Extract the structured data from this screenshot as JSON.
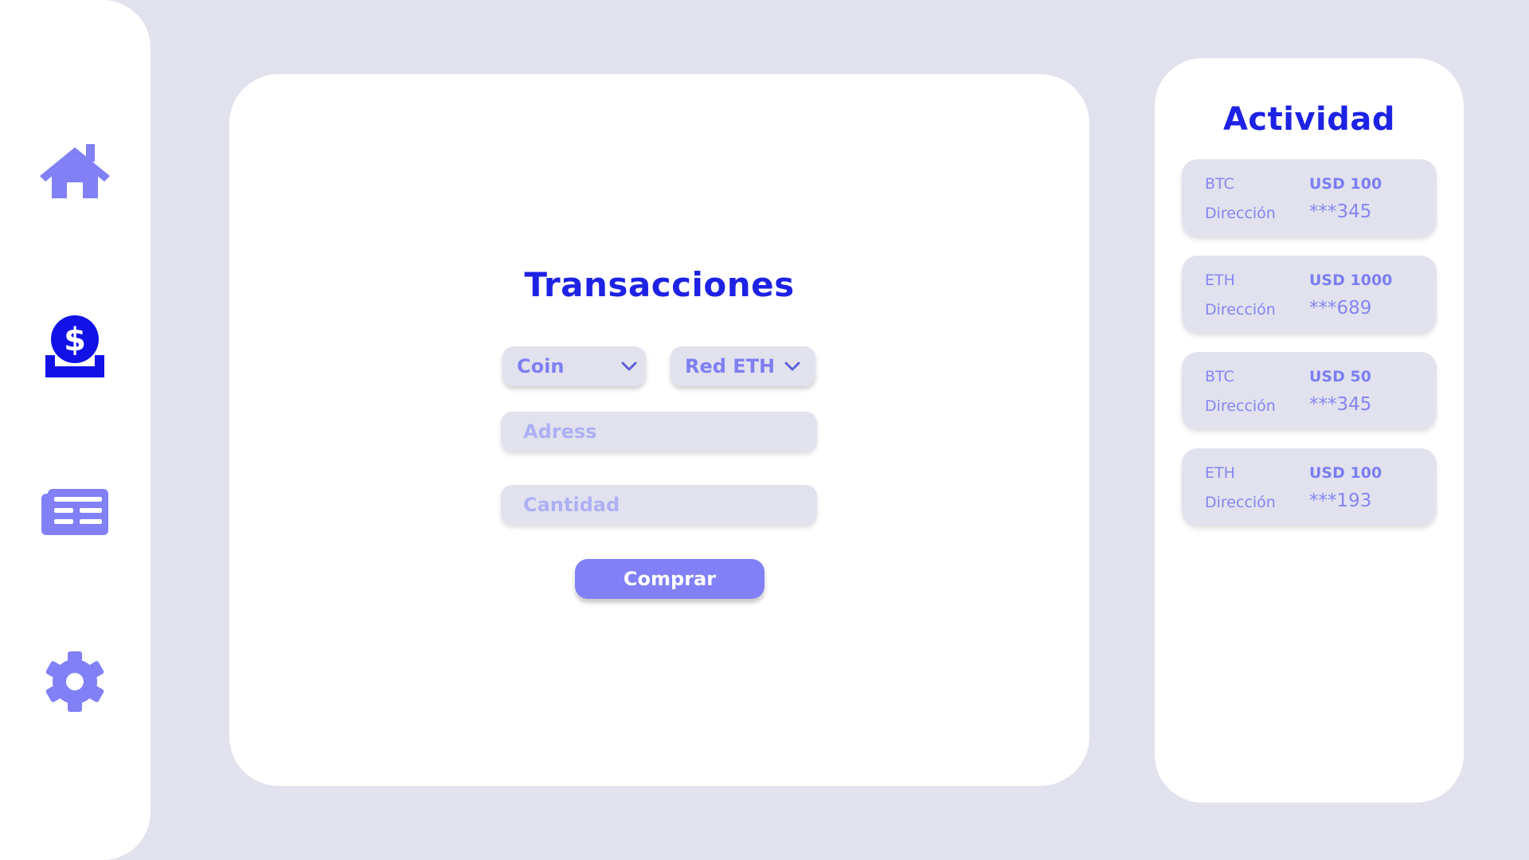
{
  "sidebar": {
    "items": [
      {
        "icon": "home-icon"
      },
      {
        "icon": "coin-deposit-icon"
      },
      {
        "icon": "news-icon"
      },
      {
        "icon": "gear-icon"
      }
    ]
  },
  "main": {
    "title": "Transacciones",
    "coin_select": "Coin",
    "network_select": "Red ETH",
    "address_placeholder": "Adress",
    "amount_placeholder": "Cantidad",
    "buy_label": "Comprar"
  },
  "activity": {
    "title": "Actividad",
    "items": [
      {
        "coin": "BTC",
        "amount": "USD 100",
        "dir_label": "Dirección",
        "address": "***345"
      },
      {
        "coin": "ETH",
        "amount": "USD 1000",
        "dir_label": "Dirección",
        "address": "***689"
      },
      {
        "coin": "BTC",
        "amount": "USD 50",
        "dir_label": "Dirección",
        "address": "***345"
      },
      {
        "coin": "ETH",
        "amount": "USD 100",
        "dir_label": "Dirección",
        "address": "***193"
      }
    ]
  },
  "colors": {
    "background": "#e1e2ee",
    "accent": "#8180f6",
    "title": "#1d22e4",
    "active_icon": "#1212e6"
  }
}
